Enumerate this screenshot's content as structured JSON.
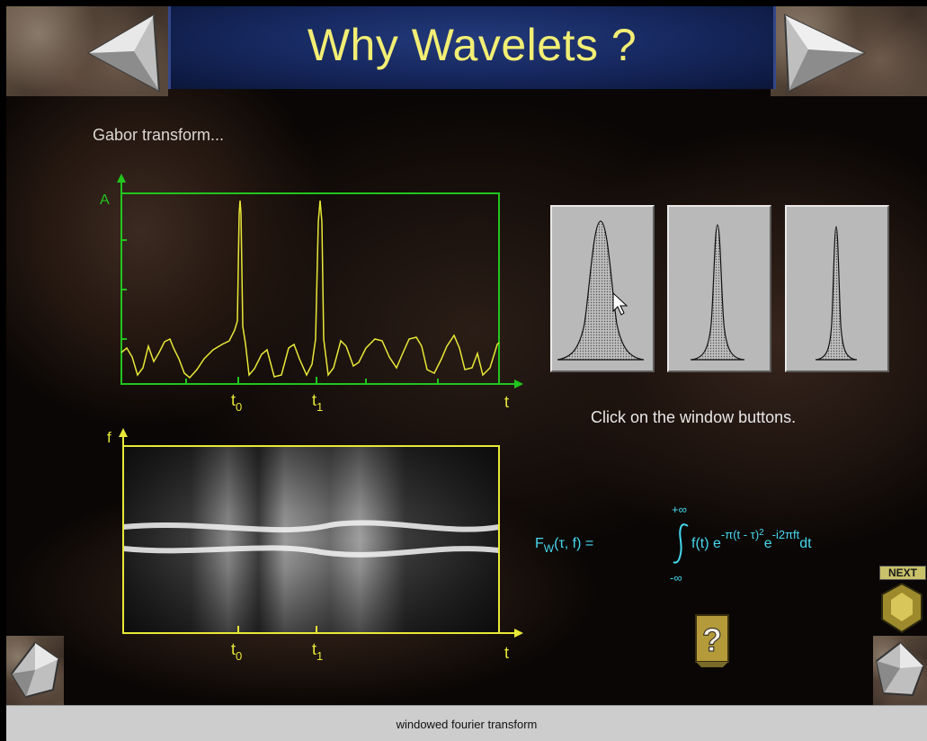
{
  "header": {
    "title": "Why Wavelets ?"
  },
  "section_label": "Gabor transform...",
  "signal_plot": {
    "amplitude_label": "A",
    "time_label": "t",
    "marker_labels": [
      "t",
      "t"
    ],
    "marker_subscripts": [
      "0",
      "1"
    ]
  },
  "spectrogram": {
    "frequency_label": "f",
    "time_label": "t",
    "marker_labels": [
      "t",
      "t"
    ],
    "marker_subscripts": [
      "0",
      "1"
    ]
  },
  "window_buttons": [
    {
      "name": "wide-window"
    },
    {
      "name": "medium-window"
    },
    {
      "name": "narrow-window"
    }
  ],
  "instruction": "Click on the window buttons.",
  "formula": {
    "lhs": "F",
    "lhs_sub": "W",
    "args": "(τ, f) =",
    "integral_upper": "+∞",
    "integral_lower": "-∞",
    "integrand": "f(t) e",
    "exp1": "-π(t - τ)",
    "exp1_power": "2",
    "e2": "e",
    "exp2": "-i2πft",
    "dt": "dt"
  },
  "next_button": {
    "label": "NEXT"
  },
  "help_button": {
    "label": "?"
  },
  "status_bar": {
    "text": "windowed fourier transform"
  },
  "colors": {
    "title": "#f2ee74",
    "plot_axes": "#22c51e",
    "signal": "#e8e838",
    "formula": "#46d8ee"
  }
}
